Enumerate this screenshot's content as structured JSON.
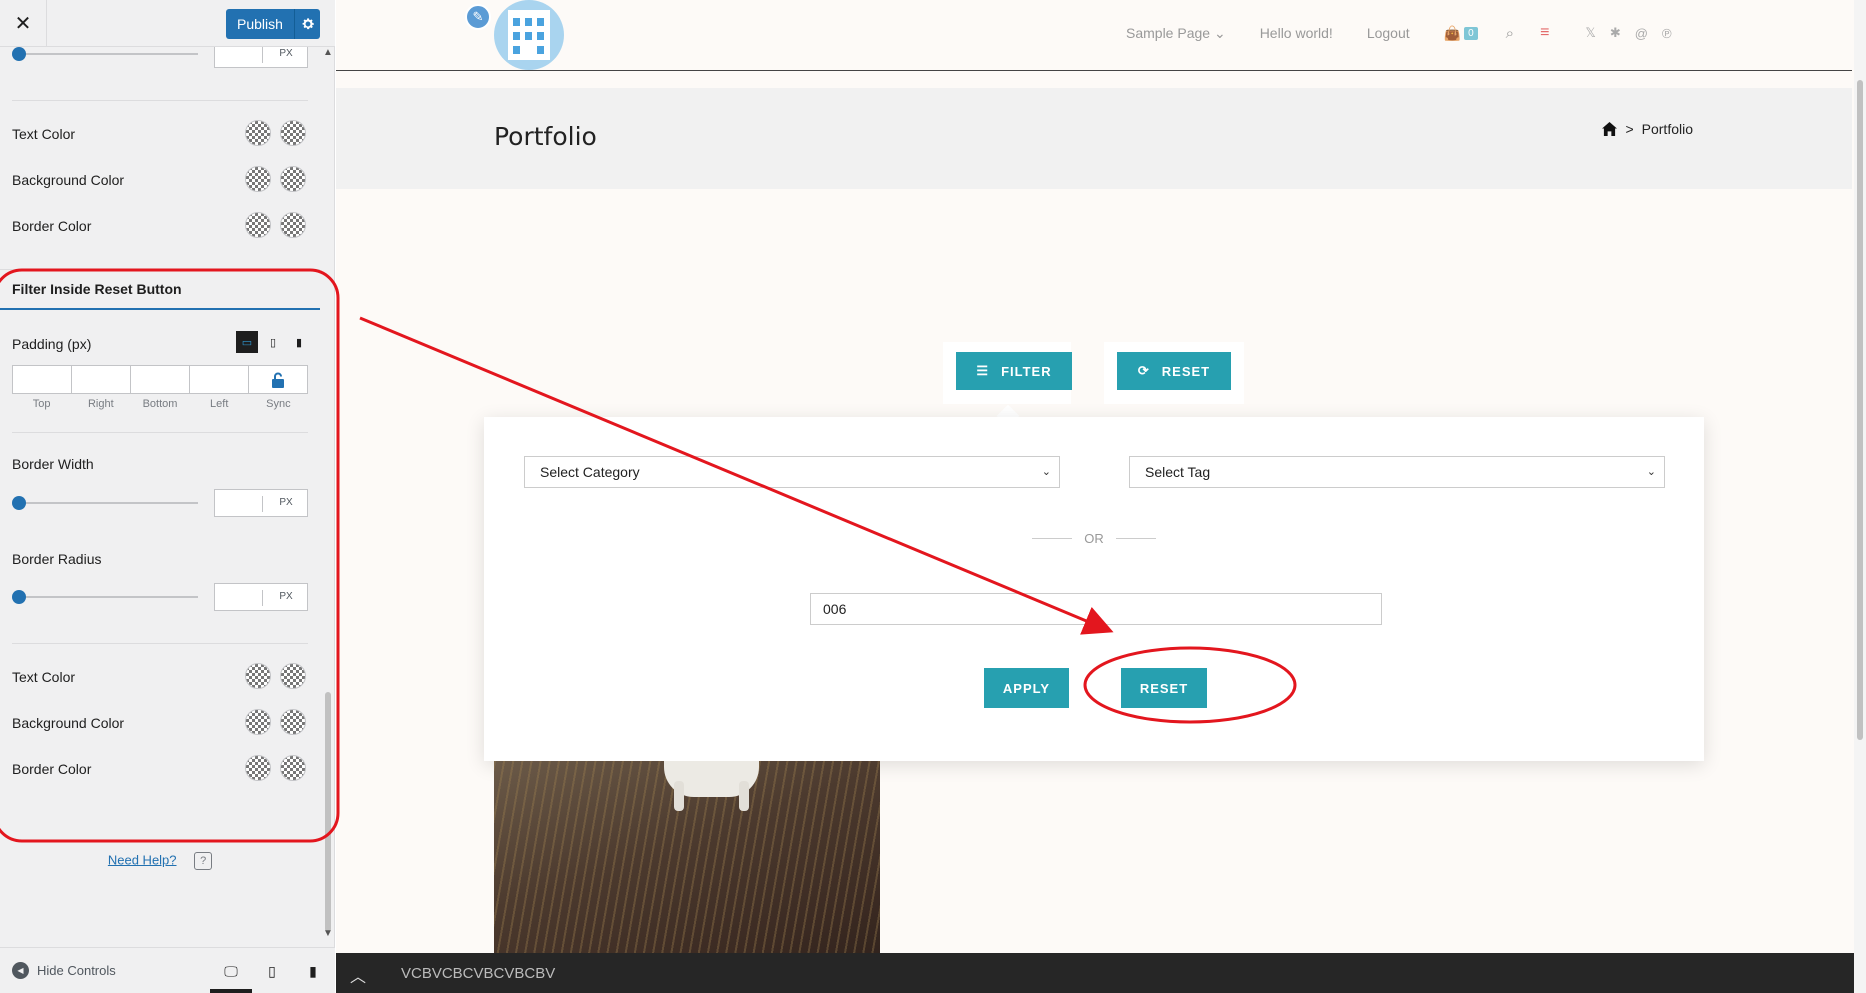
{
  "sidebar": {
    "publish_label": "Publish",
    "unit_px": "PX",
    "colors_top": {
      "text_color": "Text Color",
      "background_color": "Background Color",
      "border_color": "Border Color"
    },
    "section_title": "Filter Inside Reset Button",
    "padding_label": "Padding (px)",
    "padding_captions": [
      "Top",
      "Right",
      "Bottom",
      "Left",
      "Sync"
    ],
    "border_width_label": "Border Width",
    "border_radius_label": "Border Radius",
    "colors_bottom": {
      "text_color": "Text Color",
      "background_color": "Background Color",
      "border_color": "Border Color"
    },
    "need_help": "Need Help?",
    "help_icon_glyph": "?",
    "hide_controls": "Hide Controls"
  },
  "site": {
    "nav": {
      "sample_page": "Sample Page",
      "hello_world": "Hello world!",
      "logout": "Logout",
      "cart_count": "0"
    },
    "page_title": "Portfolio",
    "breadcrumb_current": "Portfolio",
    "breadcrumb_sep": ">",
    "filter_button": "FILTER",
    "reset_button_top": "RESET",
    "select_category": "Select Category",
    "select_tag": "Select Tag",
    "or_label": "OR",
    "search_value": "006",
    "apply_button": "APPLY",
    "reset_button": "RESET",
    "bottom_bar_text": "VCBVCBCVBCVBCBV"
  },
  "colors": {
    "accent_teal": "#27a0b0",
    "wp_blue": "#2271b1",
    "annotation_red": "#e3161e"
  }
}
